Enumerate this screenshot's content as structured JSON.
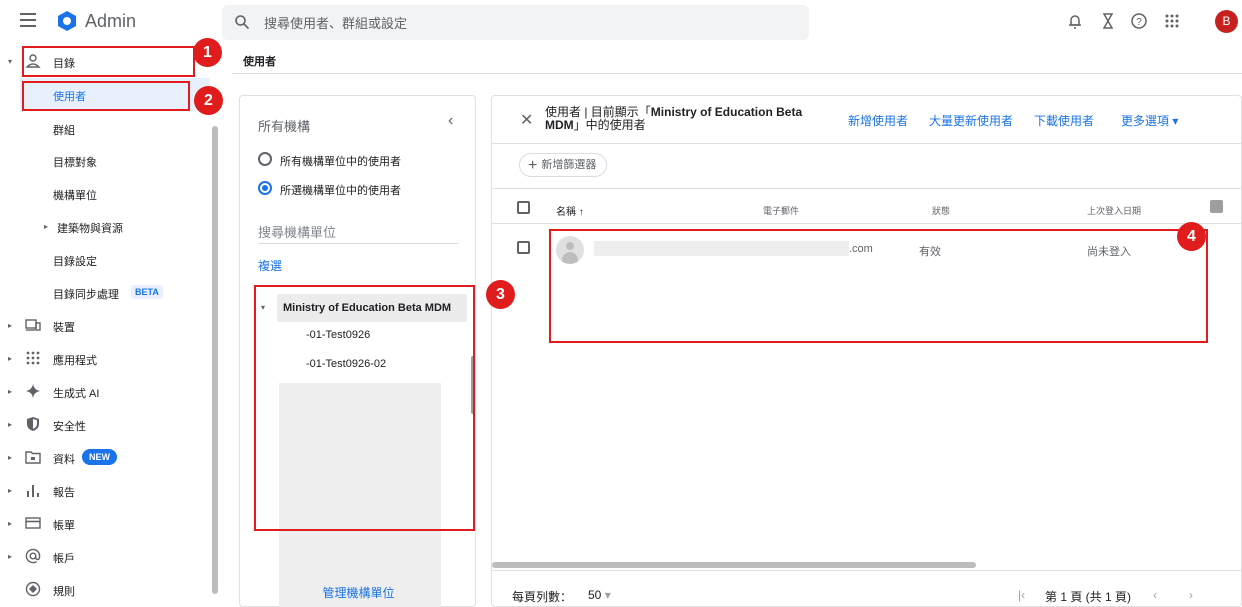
{
  "app": {
    "name": "Admin",
    "search_placeholder": "搜尋使用者、群組或設定",
    "account_initial": "B"
  },
  "topbar_icons": [
    "bell-icon",
    "hourglass-icon",
    "help-icon",
    "apps-grid-icon"
  ],
  "sidebar": {
    "items": [
      {
        "label": "目錄",
        "icon": "person-icon",
        "caret": "▾"
      },
      {
        "label": "使用者"
      },
      {
        "label": "群組"
      },
      {
        "label": "目標對象"
      },
      {
        "label": "機構單位"
      },
      {
        "label": "建築物與資源",
        "caret": "▸"
      },
      {
        "label": "目錄設定"
      },
      {
        "label": "目錄同步處理",
        "badge": "BETA"
      },
      {
        "label": "裝置",
        "icon": "devices-icon",
        "caret": "▸"
      },
      {
        "label": "應用程式",
        "icon": "apps-icon",
        "caret": "▸"
      },
      {
        "label": "生成式 AI",
        "icon": "sparkle-icon",
        "caret": "▸"
      },
      {
        "label": "安全性",
        "icon": "shield-icon",
        "caret": "▸"
      },
      {
        "label": "資料",
        "icon": "folder-icon",
        "caret": "▸",
        "badge": "NEW"
      },
      {
        "label": "報告",
        "icon": "bar-chart-icon",
        "caret": "▸"
      },
      {
        "label": "帳單",
        "icon": "billing-icon",
        "caret": "▸"
      },
      {
        "label": "帳戶",
        "icon": "at-icon",
        "caret": "▸"
      },
      {
        "label": "規則",
        "icon": "rules-icon"
      }
    ]
  },
  "breadcrumb": "使用者",
  "org_panel": {
    "title": "所有機構",
    "collapse": "‹",
    "radio_all": "所有機構單位中的使用者",
    "radio_selected": "所選機構單位中的使用者",
    "search_placeholder": "搜尋機構單位",
    "copy": "複選",
    "tree_root": "Ministry of Education Beta MDM",
    "tree_children": [
      "-01-Test0926",
      "-01-Test0926-02"
    ],
    "manage": "管理機構單位"
  },
  "main_panel": {
    "close": "✕",
    "title_prefix": "使用者 | 目前顯示「",
    "title_org": "Ministry of Education Beta MDM",
    "title_suffix": "」中的使用者",
    "actions": [
      "新增使用者",
      "大量更新使用者",
      "下載使用者",
      "更多選項 ▾"
    ],
    "filter_chip": "新增篩選器",
    "columns": {
      "name": "名稱",
      "sort": "↑",
      "email": "電子郵件",
      "status": "狀態",
      "last_login": "上次登入日期"
    },
    "rows": [
      {
        "email_suffix": ".com",
        "status": "有效",
        "last_login": "尚未登入"
      }
    ],
    "footer": {
      "rows_per_page_label": "每頁列數：",
      "rows_per_page_value": "50",
      "dropdown_caret": "▾",
      "first_page": "|‹",
      "page_info": "第 1 頁 (共 1 頁)",
      "prev": "‹",
      "next": "›"
    }
  },
  "callouts": [
    "1",
    "2",
    "3",
    "4"
  ],
  "colors": {
    "accent": "#1a73e8",
    "callout": "#e01c1c",
    "avatar": "#c5221f"
  }
}
